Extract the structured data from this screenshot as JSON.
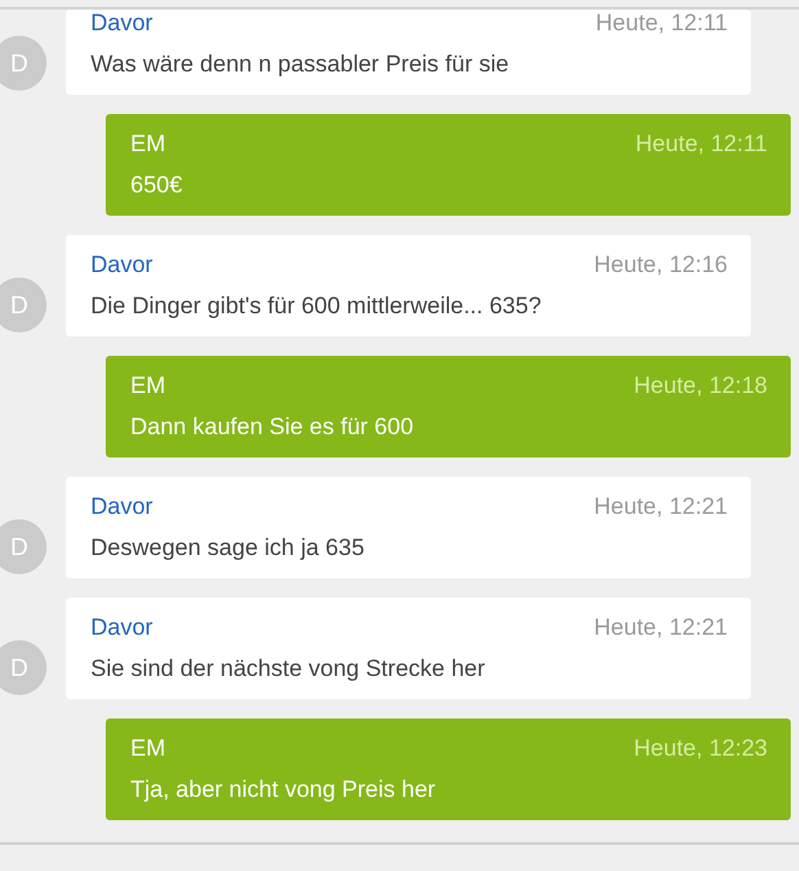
{
  "messages": [
    {
      "kind": "incoming",
      "avatar": "D",
      "sender": "Davor",
      "time": "Heute, 12:11",
      "text": "Was wäre denn n passabler Preis für sie"
    },
    {
      "kind": "outgoing",
      "sender": "EM",
      "time": "Heute, 12:11",
      "text": "650€"
    },
    {
      "kind": "incoming",
      "avatar": "D",
      "sender": "Davor",
      "time": "Heute, 12:16",
      "text": "Die Dinger gibt's für 600 mittlerweile... 635?"
    },
    {
      "kind": "outgoing",
      "sender": "EM",
      "time": "Heute, 12:18",
      "text": "Dann kaufen Sie es für 600"
    },
    {
      "kind": "incoming",
      "avatar": "D",
      "sender": "Davor",
      "time": "Heute, 12:21",
      "text": "Deswegen sage ich ja 635"
    },
    {
      "kind": "incoming",
      "avatar": "D",
      "sender": "Davor",
      "time": "Heute, 12:21",
      "text": "Sie sind der nächste vong Strecke her"
    },
    {
      "kind": "outgoing",
      "sender": "EM",
      "time": "Heute, 12:23",
      "text": "Tja, aber nicht vong Preis her"
    }
  ]
}
